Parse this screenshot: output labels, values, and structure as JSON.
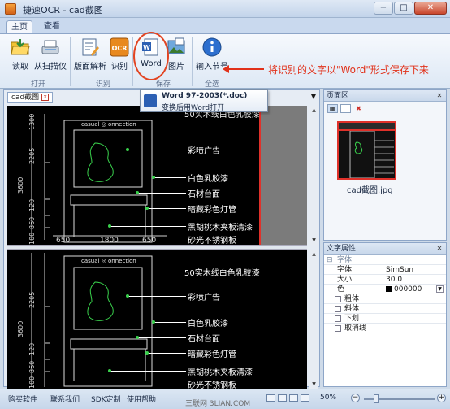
{
  "window": {
    "title": "捷速OCR - cad截图",
    "min": "−",
    "max": "□",
    "close": "✕"
  },
  "tabs": [
    "主页",
    "查看"
  ],
  "ribbon": {
    "buttons": [
      {
        "label": "读取",
        "icon": "folder-open-icon"
      },
      {
        "label": "从扫描仪",
        "icon": "scanner-icon"
      },
      {
        "label": "版面解析",
        "icon": "layout-analysis-icon"
      },
      {
        "label": "识别",
        "icon": "ocr-icon"
      },
      {
        "label": "Word",
        "icon": "word-icon"
      },
      {
        "label": "图片",
        "icon": "image-icon"
      },
      {
        "label": "输入节号",
        "icon": "info-icon"
      }
    ],
    "groups": [
      "打开",
      "识别",
      "保存",
      "全选"
    ],
    "ocr_badge": "OCR"
  },
  "annotation": "将识别的文字以\"Word\"形式保存下来",
  "tooltip": {
    "title": "Word 97-2003(*.doc)",
    "desc": "变换后用Word打开"
  },
  "document": {
    "tab_label": "cad截图",
    "top_image": {
      "brand": "casual ◎ onnection",
      "labels": [
        "彩喷广告",
        "白色乳胶漆",
        "石材台面",
        "暗藏彩色灯管",
        "黑胡桃木夹板清漆",
        "砂光不锈钢板"
      ],
      "top_cut": "50实木线白色乳胶漆",
      "dims_v": [
        "2205",
        "3600",
        "120",
        "860",
        "100",
        "1300"
      ],
      "dims_h": [
        "650",
        "1800",
        "650"
      ]
    },
    "bottom_image": {
      "brand": "casual ◎ onnection",
      "labels": [
        "50实木线白色乳胶漆",
        "彩喷广告",
        "白色乳胶漆",
        "石材台面",
        "暗藏彩色灯管",
        "黑胡桃木夹板清漆",
        "砂光不锈钢板"
      ],
      "dims_v": [
        "2205",
        "3600",
        "120",
        "860",
        "100"
      ]
    }
  },
  "page_pane": {
    "title": "页面区",
    "thumb_caption": "cad截图.jpg"
  },
  "prop_pane": {
    "title": "文字属性",
    "group": "字体",
    "rows": [
      {
        "key": "字体",
        "value": "SimSun"
      },
      {
        "key": "大小",
        "value": "30.0"
      },
      {
        "key": "色",
        "value": "000000"
      }
    ],
    "checks": [
      "粗体",
      "斜体",
      "下划",
      "取消线"
    ]
  },
  "status": {
    "links": [
      "购买软件",
      "联系我们",
      "SDK定制",
      "使用帮助"
    ],
    "zoom": "50%",
    "watermark": "三联网 3LIAN.COM"
  },
  "colors": {
    "accent_red": "#e0312a",
    "cad_green": "#39d14c"
  }
}
